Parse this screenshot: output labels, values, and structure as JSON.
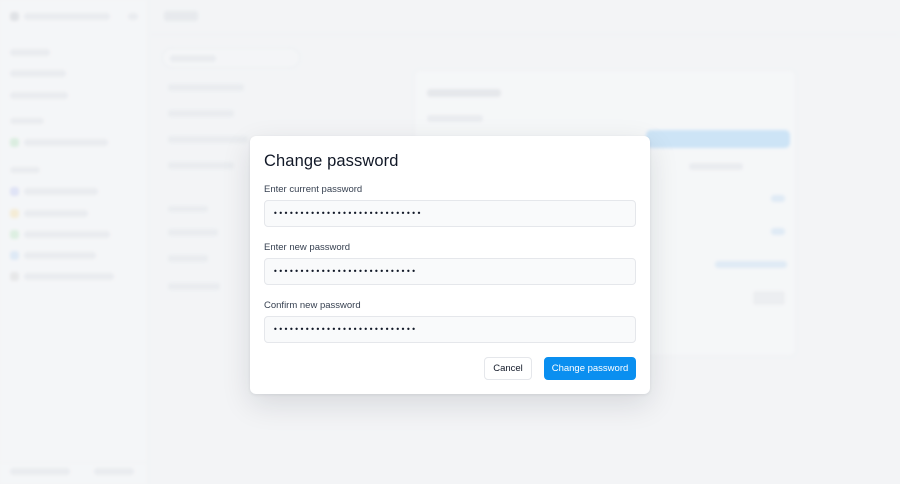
{
  "modal": {
    "title": "Change password",
    "fields": [
      {
        "label": "Enter current password",
        "value": "password-current-mask"
      },
      {
        "label": "Enter new password",
        "value": "password-new-mask"
      },
      {
        "label": "Confirm new password",
        "value": "password-confirm-mask"
      }
    ],
    "cancel_label": "Cancel",
    "submit_label": "Change password"
  },
  "masks": {
    "current": "••••••••••••••••••••••••••••",
    "new": "•••••••••••••••••••••••••••",
    "confirm": "•••••••••••••••••••••••••••"
  },
  "colors": {
    "primary": "#0a8ff0",
    "background": "#f3f4f6",
    "modal": "#ffffff"
  }
}
